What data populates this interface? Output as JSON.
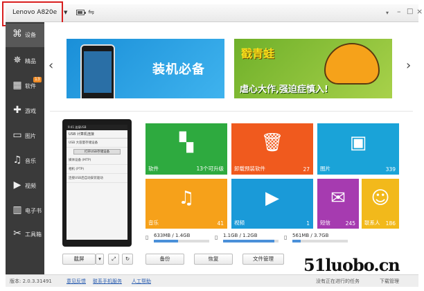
{
  "titlebar": {
    "device_name": "Lenovo A820e",
    "device_arrow": "▼",
    "battery_icon": "battery-icon",
    "usb_icon": "usb-icon",
    "menu_glyph": "▾",
    "min_glyph": "–",
    "max_glyph": "□",
    "close_glyph": "×"
  },
  "sidebar": {
    "items": [
      {
        "label": "设备",
        "icon": "⌘",
        "active": true
      },
      {
        "label": "精品",
        "icon": "✵"
      },
      {
        "label": "软件",
        "icon": "▦",
        "badge": "13"
      },
      {
        "label": "游戏",
        "icon": "✚"
      },
      {
        "label": "图片",
        "icon": "▭"
      },
      {
        "label": "音乐",
        "icon": "♫"
      },
      {
        "label": "视频",
        "icon": "▶"
      },
      {
        "label": "电子书",
        "icon": "▥"
      },
      {
        "label": "工具箱",
        "icon": "✂"
      }
    ]
  },
  "banner": {
    "left_text": "装机必备",
    "right_title": "戳青蛙",
    "right_text": "虐心大作,强迫症慎入!",
    "prev_glyph": "‹",
    "next_glyph": "›"
  },
  "phone": {
    "status": "9:41 连接USB",
    "title": "USB 计算机连接",
    "lines": [
      "USB 大容量存储设备",
      "打开USB存储设备",
      "媒体设备 (MTP)",
      "相机 (PTP)",
      "连接USB后自动安装驱动"
    ]
  },
  "tiles": [
    {
      "label": "软件",
      "count": "13个可升级",
      "icon": "▚",
      "color": "#2eaa3f"
    },
    {
      "label": "卸载预装软件",
      "count": "27",
      "icon": "🗑",
      "color": "#f05a1e"
    },
    {
      "label": "图片",
      "count": "339",
      "icon": "▣",
      "color": "#1aa3d8"
    },
    {
      "label": "音乐",
      "count": "41",
      "icon": "♫",
      "color": "#f6a11a"
    },
    {
      "label": "视频",
      "count": "1",
      "icon": "▶",
      "color": "#1a9ad8"
    },
    {
      "label": "短信",
      "count": "245",
      "icon": "✉",
      "color": "#a63bb0"
    },
    {
      "label": "联系人",
      "count": "186",
      "icon": "☺",
      "color": "#f2b91b"
    }
  ],
  "storage": [
    {
      "text": "633MB / 1.4GB",
      "fill": 0.44
    },
    {
      "text": "1.1GB / 1.2GB",
      "fill": 0.92
    },
    {
      "text": "561MB / 3.7GB",
      "fill": 0.15
    }
  ],
  "buttons": {
    "screenshot": "截屏",
    "screenshot_arrow": "▾",
    "fullscreen_glyph": "⤢",
    "refresh_glyph": "↻",
    "backup": "备份",
    "restore": "恢复",
    "file_manager": "文件管理"
  },
  "footer": {
    "version": "版本: 2.0.3.31491",
    "feedback": "意见反馈",
    "contact": "联系手机服务",
    "help": "人工帮助",
    "tasks": "没有正在进行的任务",
    "download": "下载管理"
  },
  "watermark": "51luobo.cn"
}
